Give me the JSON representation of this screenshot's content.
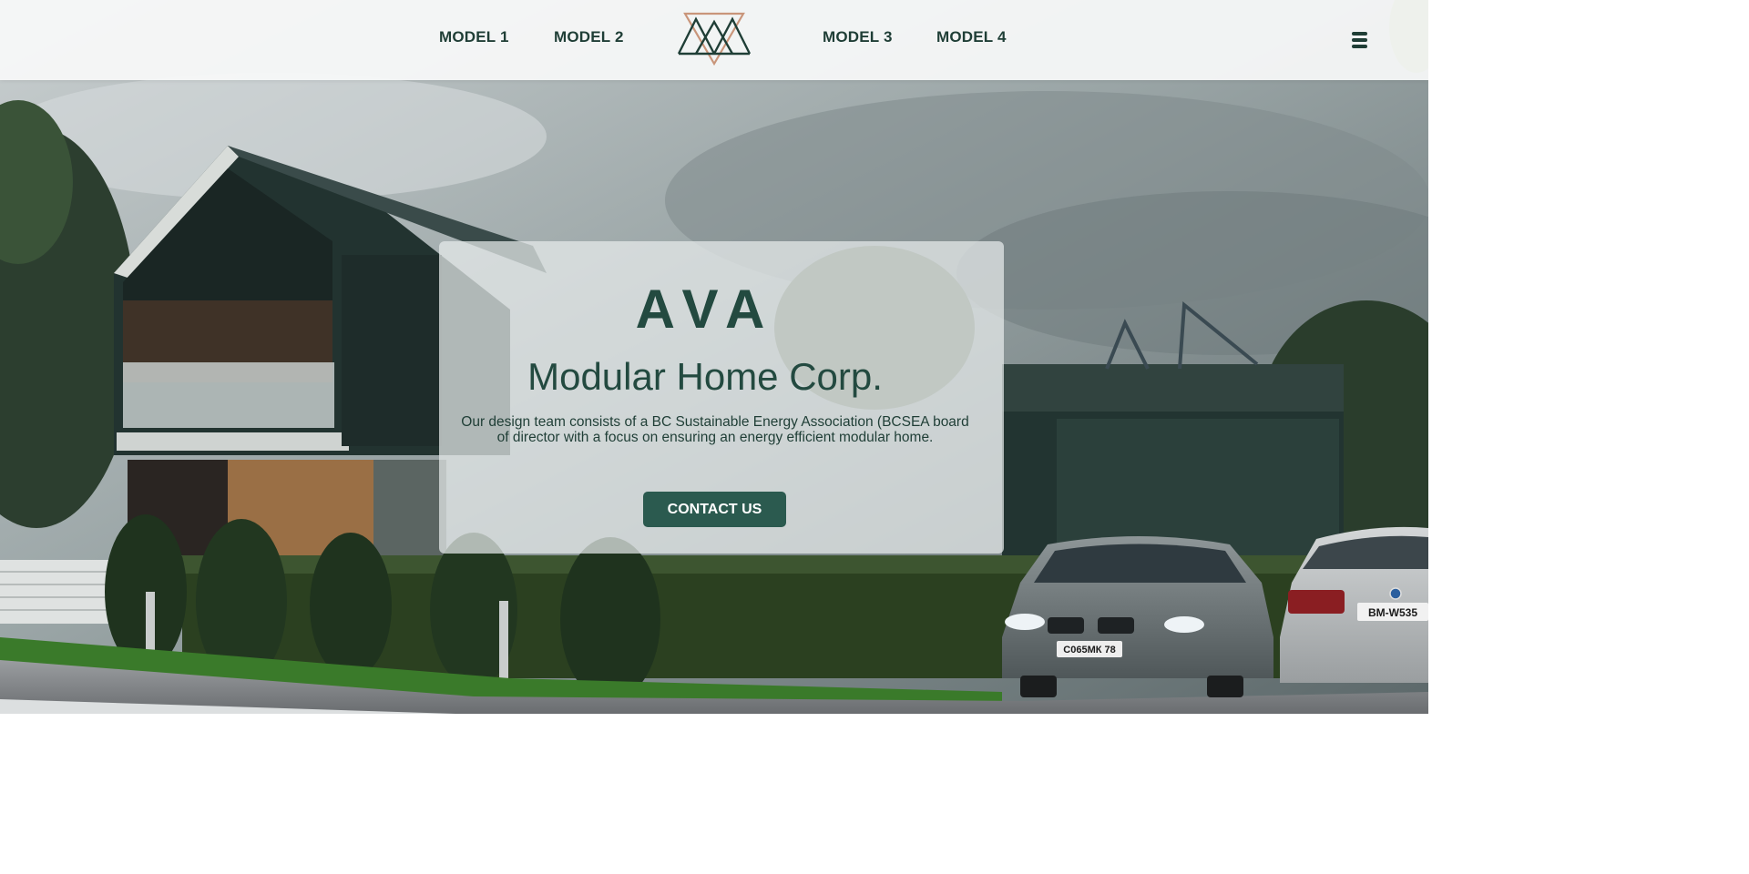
{
  "nav": {
    "left_links": [
      {
        "label": "MODEL 1"
      },
      {
        "label": "MODEL 2"
      }
    ],
    "right_links": [
      {
        "label": "MODEL 3"
      },
      {
        "label": "MODEL 4"
      }
    ],
    "logo_icon": "ava-triangle-logo-icon",
    "menu_icon": "hamburger-menu-icon"
  },
  "hero": {
    "brand": "AVA",
    "tagline": "Modular Home Corp.",
    "description": "Our design team consists of a BC Sustainable Energy Association (BCSEA board of director with a focus on ensuring an energy efficient modular home.",
    "cta_label": "CONTACT US"
  },
  "background": {
    "car_plate_front": "C065MK 78",
    "car_plate_right": "BM-W535"
  },
  "colors": {
    "brand_green": "#234a40",
    "button_green": "#2b5a4f",
    "logo_accent": "#c9957a",
    "header_bg": "#f7f9f9"
  }
}
